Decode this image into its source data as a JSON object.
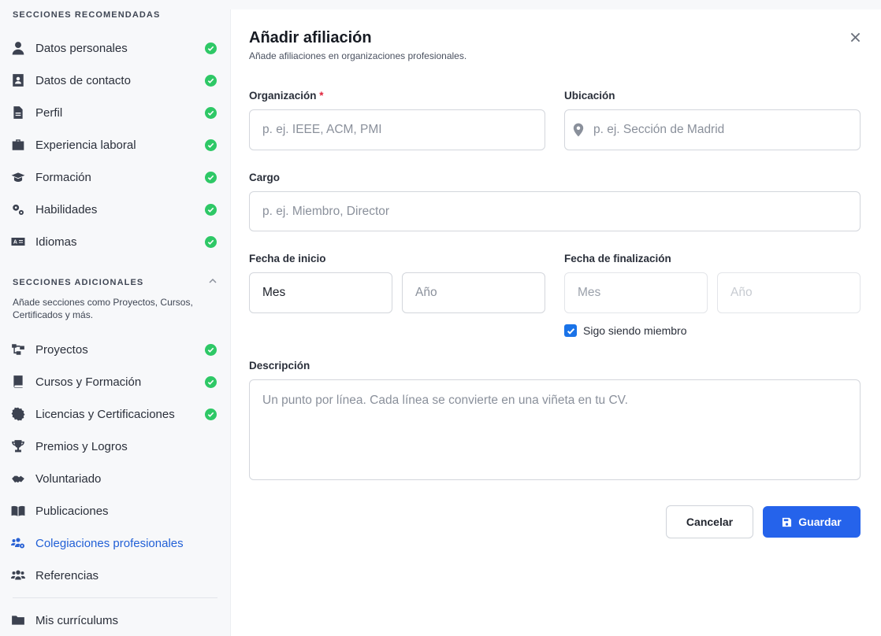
{
  "sidebar": {
    "recommended_title": "SECCIONES RECOMENDADAS",
    "recommended": [
      {
        "label": "Datos personales",
        "icon": "user-icon",
        "done": true
      },
      {
        "label": "Datos de contacto",
        "icon": "contact-card-icon",
        "done": true
      },
      {
        "label": "Perfil",
        "icon": "document-icon",
        "done": true
      },
      {
        "label": "Experiencia laboral",
        "icon": "briefcase-icon",
        "done": true
      },
      {
        "label": "Formación",
        "icon": "graduation-cap-icon",
        "done": true
      },
      {
        "label": "Habilidades",
        "icon": "gears-icon",
        "done": true
      },
      {
        "label": "Idiomas",
        "icon": "language-icon",
        "done": true
      }
    ],
    "additional_title": "SECCIONES ADICIONALES",
    "additional_desc": "Añade secciones como Proyectos, Cursos, Certificados y más.",
    "additional": [
      {
        "label": "Proyectos",
        "icon": "project-diagram-icon",
        "done": true
      },
      {
        "label": "Cursos y Formación",
        "icon": "book-icon",
        "done": true
      },
      {
        "label": "Licencias y Certificaciones",
        "icon": "certificate-icon",
        "done": true
      },
      {
        "label": "Premios y Logros",
        "icon": "trophy-icon",
        "done": false
      },
      {
        "label": "Voluntariado",
        "icon": "handshake-icon",
        "done": false
      },
      {
        "label": "Publicaciones",
        "icon": "open-book-icon",
        "done": false
      },
      {
        "label": "Colegiaciones profesionales",
        "icon": "users-cog-icon",
        "done": false,
        "active": true
      },
      {
        "label": "Referencias",
        "icon": "users-icon",
        "done": false
      }
    ],
    "footer_item": {
      "label": "Mis currículums",
      "icon": "folder-icon"
    }
  },
  "form": {
    "title": "Añadir afiliación",
    "subtitle": "Añade afiliaciones en organizaciones profesionales.",
    "organization_label": "Organización",
    "required_mark": "*",
    "organization_placeholder": "p. ej. IEEE, ACM, PMI",
    "location_label": "Ubicación",
    "location_placeholder": "p. ej. Sección de Madrid",
    "role_label": "Cargo",
    "role_placeholder": "p. ej. Miembro, Director",
    "start_label": "Fecha de inicio",
    "start_month": "Mes",
    "start_year": "Año",
    "end_label": "Fecha de finalización",
    "end_month": "Mes",
    "end_year": "Año",
    "still_member_label": "Sigo siendo miembro",
    "still_member_checked": true,
    "description_label": "Descripción",
    "description_placeholder": "Un punto por línea. Cada línea se convierte en una viñeta en tu CV.",
    "cancel_label": "Cancelar",
    "save_label": "Guardar"
  },
  "colors": {
    "accent": "#2563eb",
    "check_green": "#2ec866",
    "required_red": "#e0243c",
    "active_nav": "#2260d6"
  }
}
